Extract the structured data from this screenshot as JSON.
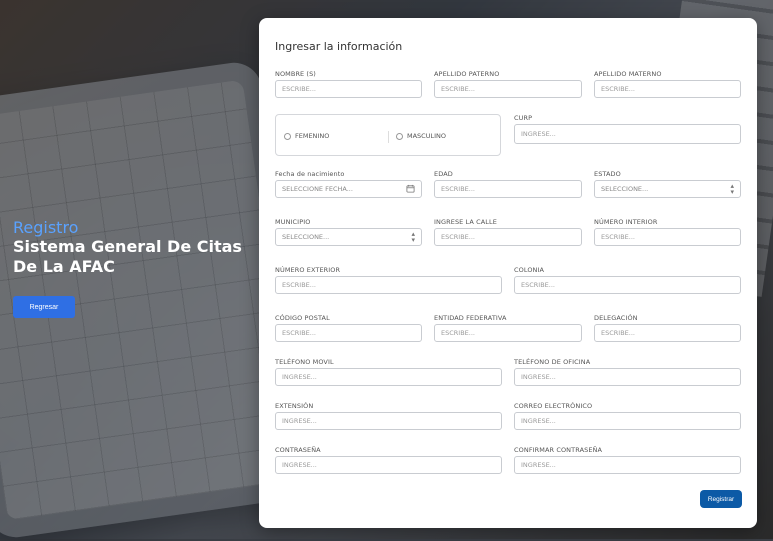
{
  "hero": {
    "subtitle": "Registro",
    "title": "Sistema General De Citas De La AFAC",
    "button": "Regresar"
  },
  "form": {
    "title": "Ingresar la información",
    "fields": {
      "nombre": {
        "label": "NOMBRE (S)",
        "placeholder": "ESCRIBE..."
      },
      "apellido_paterno": {
        "label": "APELLIDO PATERNO",
        "placeholder": "ESCRIBE..."
      },
      "apellido_materno": {
        "label": "APELLIDO MATERNO",
        "placeholder": "ESCRIBE..."
      },
      "curp": {
        "label": "CURP",
        "placeholder": "INGRESE..."
      },
      "fecha_nacimiento": {
        "label": "Fecha de nacimiento",
        "placeholder": "SELECCIONE FECHA..."
      },
      "edad": {
        "label": "EDAD",
        "placeholder": "ESCRIBE..."
      },
      "estado": {
        "label": "ESTADO",
        "placeholder": "SELECCIONE..."
      },
      "municipio": {
        "label": "MUNICIPIO",
        "placeholder": "SELECCIONE..."
      },
      "calle": {
        "label": "INGRESE LA CALLE",
        "placeholder": "ESCRIBE..."
      },
      "numero_interior": {
        "label": "NÚMERO INTERIOR",
        "placeholder": "ESCRIBE..."
      },
      "numero_exterior": {
        "label": "NÚMERO EXTERIOR",
        "placeholder": "ESCRIBE..."
      },
      "colonia": {
        "label": "COLONIA",
        "placeholder": "ESCRIBE..."
      },
      "codigo_postal": {
        "label": "CÓDIGO POSTAL",
        "placeholder": "ESCRIBE..."
      },
      "entidad_federativa": {
        "label": "ENTIDAD FEDERATIVA",
        "placeholder": "ESCRIBE..."
      },
      "delegacion": {
        "label": "DELEGACIÓN",
        "placeholder": "ESCRIBE..."
      },
      "telefono_movil": {
        "label": "TELÉFONO MOVIL",
        "placeholder": "INGRESE..."
      },
      "telefono_oficina": {
        "label": "TELÉFONO DE OFICINA",
        "placeholder": "INGRESE..."
      },
      "extension": {
        "label": "EXTENSIÓN",
        "placeholder": "INGRESE..."
      },
      "correo": {
        "label": "CORREO ELECTRÓNICO",
        "placeholder": "INGRESE..."
      },
      "contrasena": {
        "label": "CONTRASEÑA",
        "placeholder": "INGRESE..."
      },
      "confirmar_contrasena": {
        "label": "CONFIRMAR CONTRASEÑA",
        "placeholder": "INGRESE..."
      }
    },
    "gender": {
      "female": "FEMENINO",
      "male": "MASCULINO"
    },
    "submit": "Registrar"
  },
  "colors": {
    "accent": "#2f6fe4",
    "submit": "#0c5aa6",
    "hero_subtitle": "#5aa2ff"
  }
}
